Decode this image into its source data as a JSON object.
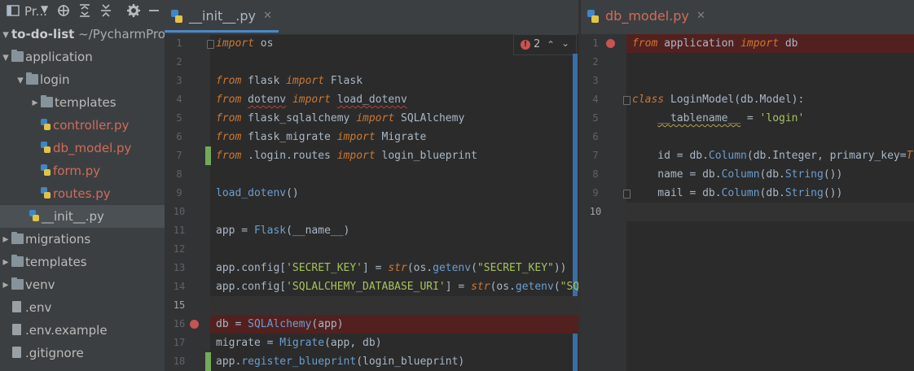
{
  "project_toolbar": {
    "title": "Pr..."
  },
  "tree": [
    {
      "label": "to-do-list",
      "suffix": "~/PycharmProject",
      "type": "root",
      "depth": 0,
      "expanded": true
    },
    {
      "label": "application",
      "type": "folder",
      "depth": 0,
      "expanded": true
    },
    {
      "label": "login",
      "type": "folder",
      "depth": 1,
      "expanded": true
    },
    {
      "label": "templates",
      "type": "folder",
      "depth": 2,
      "expanded": false
    },
    {
      "label": "controller.py",
      "type": "py",
      "depth": 3,
      "error": true
    },
    {
      "label": "db_model.py",
      "type": "py",
      "depth": 3,
      "error": true
    },
    {
      "label": "form.py",
      "type": "py",
      "depth": 3,
      "error": true
    },
    {
      "label": "routes.py",
      "type": "py",
      "depth": 3,
      "error": true
    },
    {
      "label": "__init__.py",
      "type": "py",
      "depth": 2,
      "selected": true
    },
    {
      "label": "migrations",
      "type": "folder",
      "depth": 0,
      "expanded": false
    },
    {
      "label": "templates",
      "type": "folder",
      "depth": 0,
      "expanded": false
    },
    {
      "label": "venv",
      "type": "folder",
      "depth": 0,
      "expanded": false
    },
    {
      "label": ".env",
      "type": "file",
      "depth": 0
    },
    {
      "label": ".env.example",
      "type": "file",
      "depth": 0
    },
    {
      "label": ".gitignore",
      "type": "file",
      "depth": 0
    }
  ],
  "editor_left": {
    "tab_label": "__init__.py",
    "error_count": "2",
    "lines": [
      {
        "n": "1",
        "html": "<span class=\"kw\">import</span> os"
      },
      {
        "n": "2",
        "html": ""
      },
      {
        "n": "3",
        "html": "<span class=\"kw\">from</span> flask <span class=\"kw\">import</span> Flask"
      },
      {
        "n": "4",
        "html": "<span class=\"kw\">from</span> <span class=\"squig\">dotenv</span> <span class=\"kw\">import</span> <span class=\"squig\">load_dotenv</span>"
      },
      {
        "n": "5",
        "html": "<span class=\"kw\">from</span> flask_sqlalchemy <span class=\"kw\">import</span> SQLAlchemy"
      },
      {
        "n": "6",
        "html": "<span class=\"kw\">from</span> flask_migrate <span class=\"kw\">import</span> Migrate"
      },
      {
        "n": "7",
        "html": "<span class=\"kw\">from</span> .login.routes <span class=\"kw\">import</span> login_blueprint"
      },
      {
        "n": "8",
        "html": ""
      },
      {
        "n": "9",
        "html": "<span class=\"call\">load_dotenv</span>()"
      },
      {
        "n": "10",
        "html": ""
      },
      {
        "n": "11",
        "html": "app = <span class=\"call\">Flask</span>(__name__)"
      },
      {
        "n": "12",
        "html": ""
      },
      {
        "n": "13",
        "html": "app.config[<span class=\"str\">'SECRET_KEY'</span>] = <span class=\"stri\">str</span>(os.<span class=\"call\">getenv</span>(<span class=\"str\">\"SECRET_KEY\"</span>))"
      },
      {
        "n": "14",
        "html": "app.config[<span class=\"str\">'SQLALCHEMY_DATABASE_URI'</span>] = <span class=\"stri\">str</span>(os.<span class=\"call\">getenv</span>(<span class=\"str\">\"SQLALCHEM</span>"
      },
      {
        "n": "15",
        "html": ""
      },
      {
        "n": "16",
        "html": "db = <span class=\"call\">SQLAlchemy</span>(app)"
      },
      {
        "n": "17",
        "html": "migrate = <span class=\"call\">Migrate</span>(app, db)"
      },
      {
        "n": "18",
        "html": "app.<span class=\"call\">register_blueprint</span>(login_blueprint)"
      }
    ]
  },
  "editor_right": {
    "tab_label": "db_model.py",
    "lines": [
      {
        "n": "1",
        "html": "<span class=\"kw\">from</span> application <span class=\"kw\">import</span> db"
      },
      {
        "n": "2",
        "html": ""
      },
      {
        "n": "3",
        "html": ""
      },
      {
        "n": "4",
        "html": "<span class=\"kw\">class</span> LoginModel(db.Model):"
      },
      {
        "n": "5",
        "html": "    <span class=\"squigy\">__tablename__</span> = <span class=\"str\">'login'</span>"
      },
      {
        "n": "6",
        "html": ""
      },
      {
        "n": "7",
        "html": "    id = db.<span class=\"call\">Column</span>(db.Integer, primary_key=<span class=\"stri\">True</span>)"
      },
      {
        "n": "8",
        "html": "    name = db.<span class=\"call\">Column</span>(db.<span class=\"call\">String</span>())"
      },
      {
        "n": "9",
        "html": "    mail = db.<span class=\"call\">Column</span>(db.<span class=\"call\">String</span>())"
      },
      {
        "n": "10",
        "html": ""
      }
    ]
  }
}
